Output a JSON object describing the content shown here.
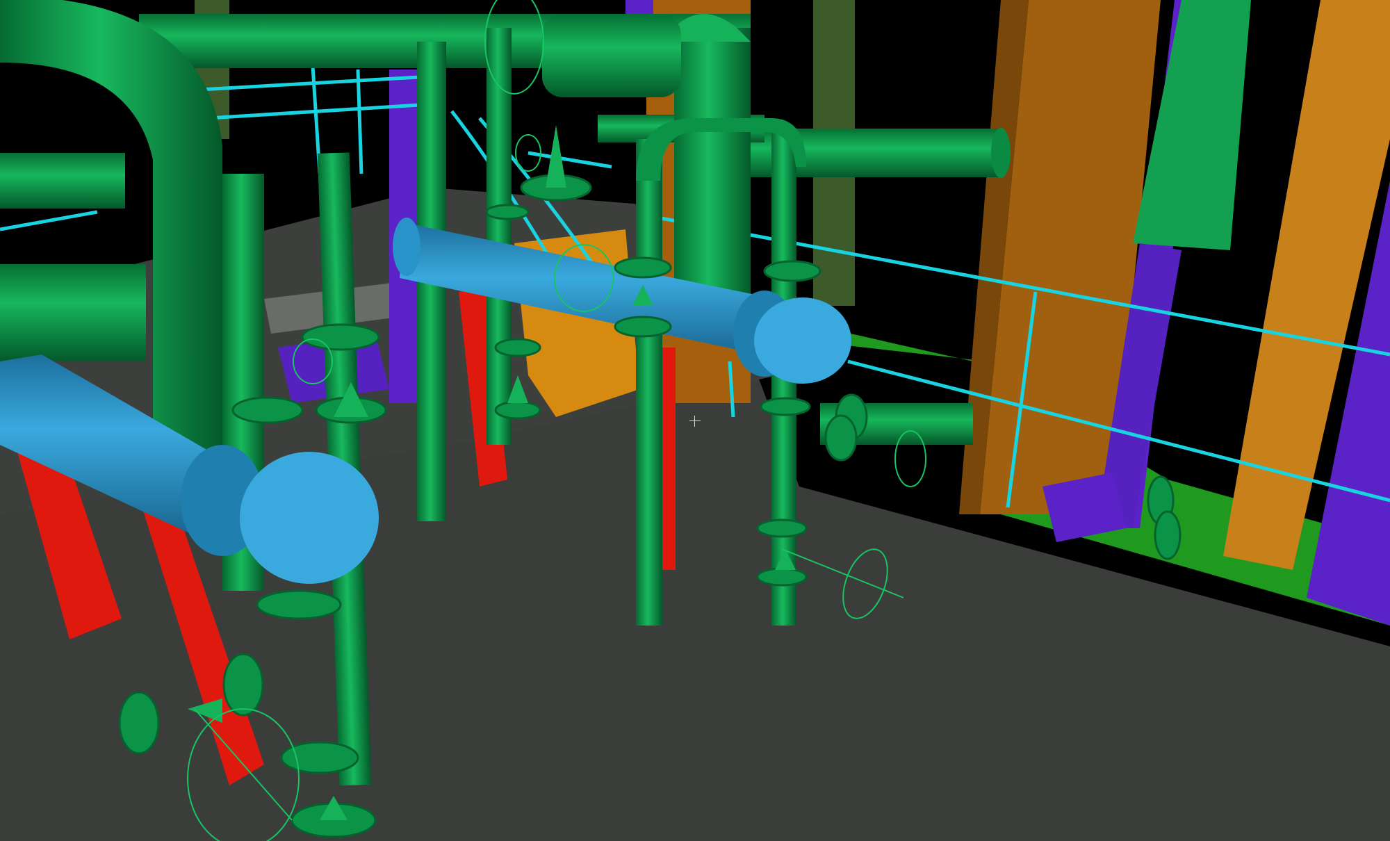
{
  "viewport": {
    "background": "#000000",
    "cursor": "crosshair"
  },
  "palette": {
    "floor": "#3a3d3a",
    "floor_edge": "#4a4d4a",
    "pipe_green": "#0b9448",
    "pipe_green_light": "#16b25a",
    "pipe_green_dark": "#056b32",
    "pipe_blue": "#2793c8",
    "pipe_blue_light": "#3aa9de",
    "pipe_blue_dark": "#1c6f9c",
    "railing_cyan": "#19d4e0",
    "support_red": "#e0190f",
    "structure_orange": "#c7801a",
    "structure_brown": "#9a5a10",
    "structure_purple": "#5b22c8",
    "structure_olive": "#3d5a2a",
    "equipment_yellow": "#d68a10",
    "floor_green": "#20a020",
    "crosshair": "#d8d8d8"
  }
}
